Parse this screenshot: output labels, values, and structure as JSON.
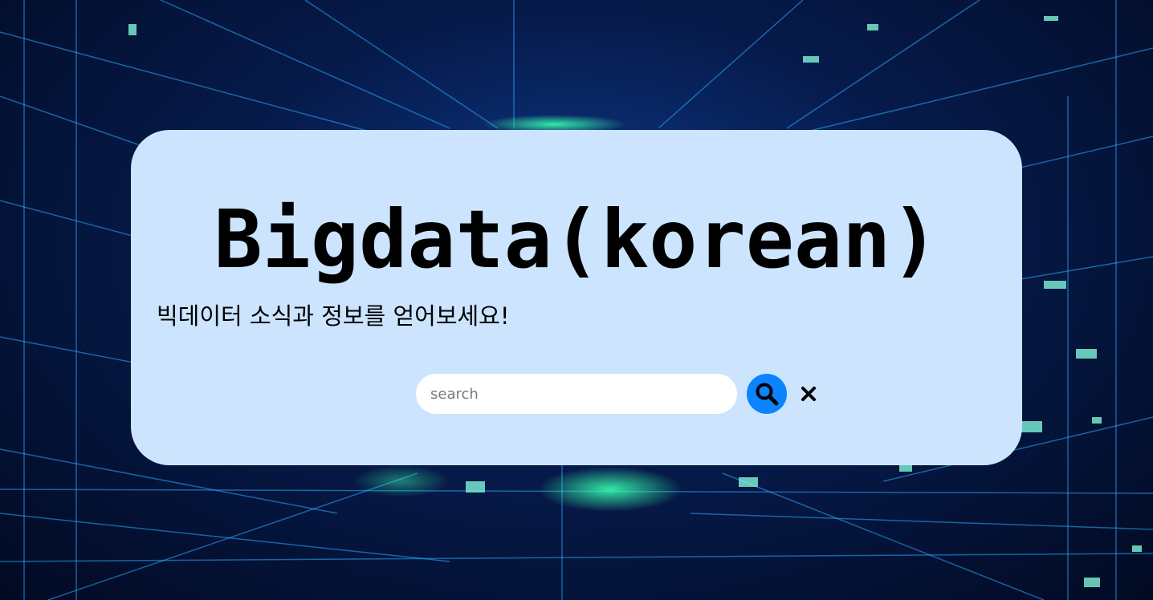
{
  "hero": {
    "title": "Bigdata(korean)",
    "subtitle": "빅데이터 소식과 정보를 얻어보세요!"
  },
  "search": {
    "value": "",
    "placeholder": "search",
    "submit_icon": "search-icon",
    "clear_icon": "close-icon"
  },
  "colors": {
    "card": "#cce4fd",
    "search_button": "#0a84ff",
    "background": "#061a4a"
  }
}
